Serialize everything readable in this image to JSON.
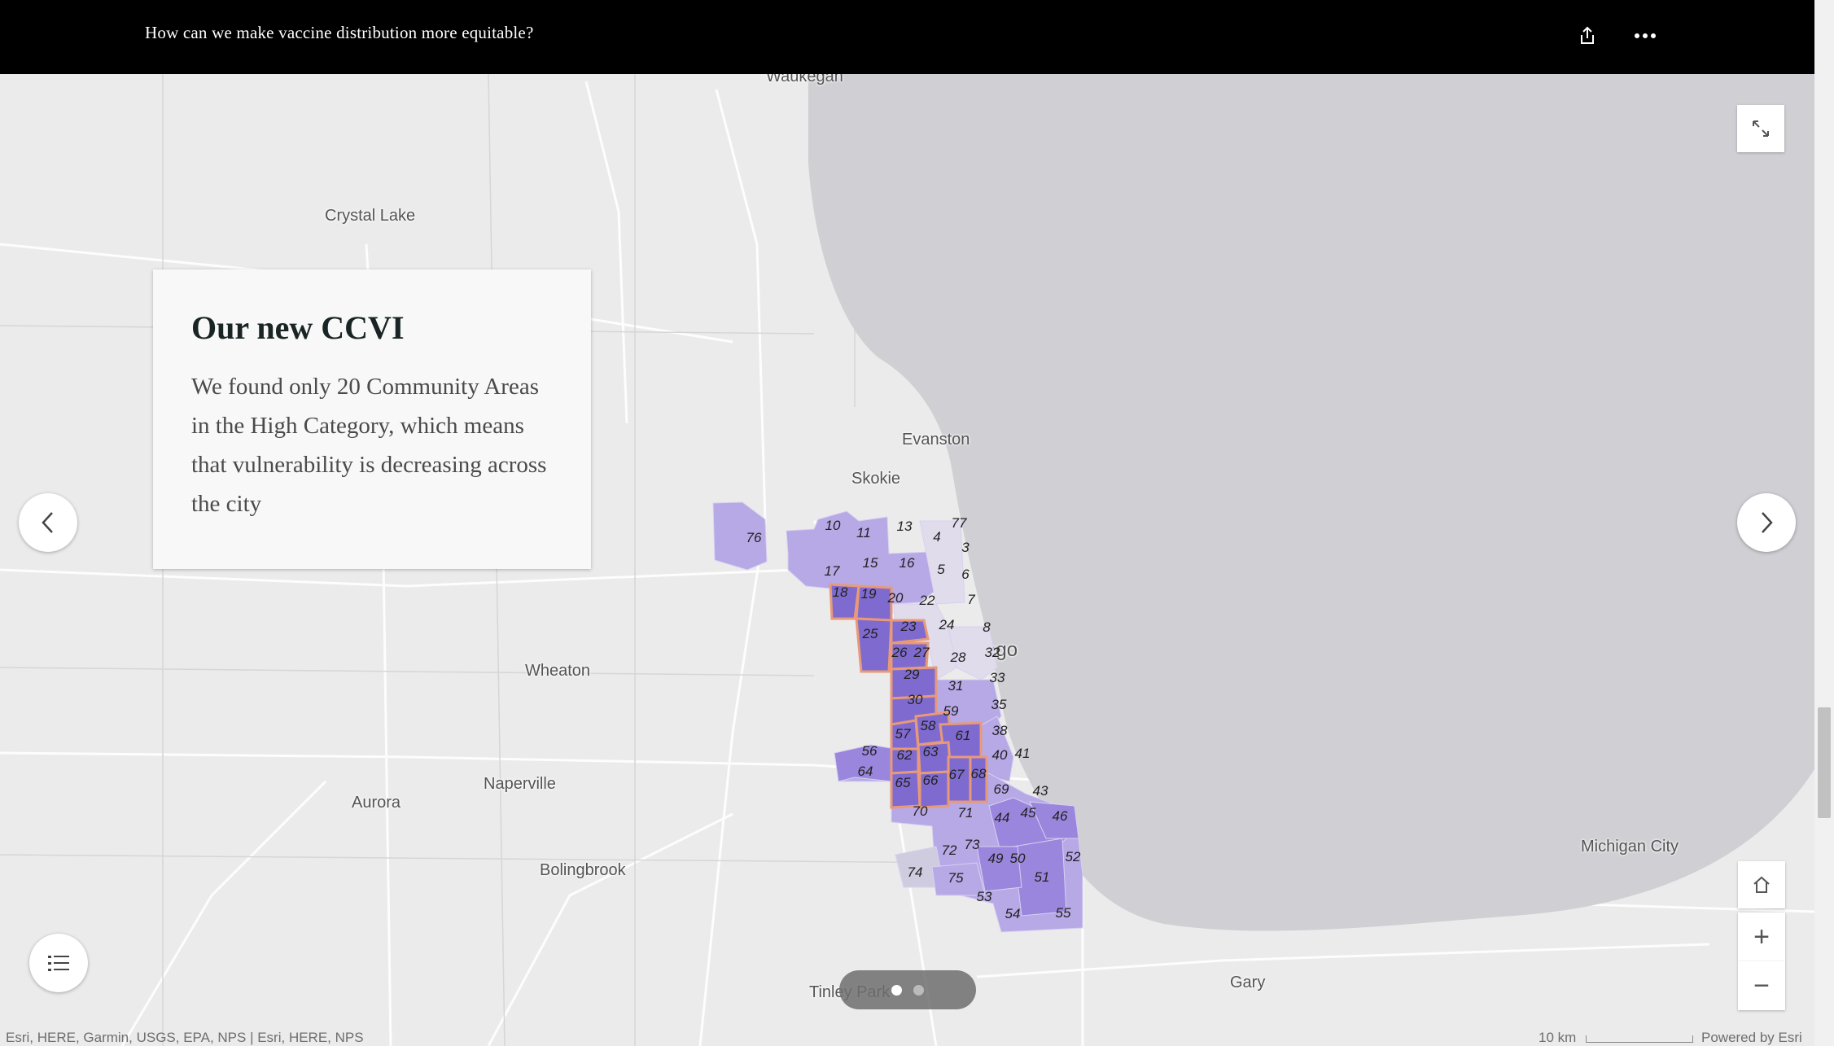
{
  "header": {
    "title": "How can we make vaccine distribution more equitable?",
    "share_icon": "share-icon",
    "more_icon": "more-icon"
  },
  "card": {
    "heading": "Our new CCVI",
    "body": "We found only 20 Community Areas in the High Category, which means that vulnerability is decreasing across the city"
  },
  "places": {
    "waukegan": "Waukegan",
    "crystal_lake": "Crystal Lake",
    "evanston": "Evanston",
    "skokie": "Skokie",
    "chicago": "Chicago",
    "wheaton": "Wheaton",
    "naperville": "Naperville",
    "aurora": "Aurora",
    "bolingbrook": "Bolingbrook",
    "michigan_city": "Michigan City",
    "gary": "Gary",
    "tinley_park": "Tinley Park"
  },
  "community_areas": {
    "high": [
      "18",
      "19",
      "23",
      "25",
      "26",
      "29",
      "30",
      "57",
      "58",
      "61",
      "62",
      "63",
      "65",
      "66",
      "67",
      "68"
    ],
    "labels": [
      "76",
      "10",
      "11",
      "13",
      "77",
      "4",
      "3",
      "17",
      "15",
      "16",
      "5",
      "6",
      "18",
      "19",
      "20",
      "22",
      "7",
      "25",
      "23",
      "24",
      "8",
      "26",
      "27",
      "28",
      "32",
      "29",
      "31",
      "33",
      "30",
      "59",
      "35",
      "57",
      "58",
      "61",
      "38",
      "56",
      "62",
      "63",
      "40",
      "41",
      "64",
      "65",
      "66",
      "67",
      "68",
      "69",
      "43",
      "70",
      "71",
      "44",
      "45",
      "46",
      "72",
      "73",
      "49",
      "50",
      "52",
      "74",
      "75",
      "51",
      "53",
      "54",
      "55"
    ]
  },
  "colors": {
    "water": "#cfcfd4",
    "land": "#ebebeb",
    "area_low": "#b7a8e6",
    "area_mid": "#9a87dd",
    "area_high": "#7f6bcf",
    "high_outline": "#e89a78"
  },
  "controls": {
    "expand_icon": "expand-icon",
    "home_icon": "home-icon",
    "zoom_in": "+",
    "zoom_out": "−",
    "legend_icon": "legend-list-icon"
  },
  "pager": {
    "active_index": 0,
    "count": 2
  },
  "footer": {
    "attribution": "Esri, HERE, Garmin, USGS, EPA, NPS | Esri, HERE, NPS",
    "scale": "10 km",
    "powered": "Powered by Esri"
  }
}
